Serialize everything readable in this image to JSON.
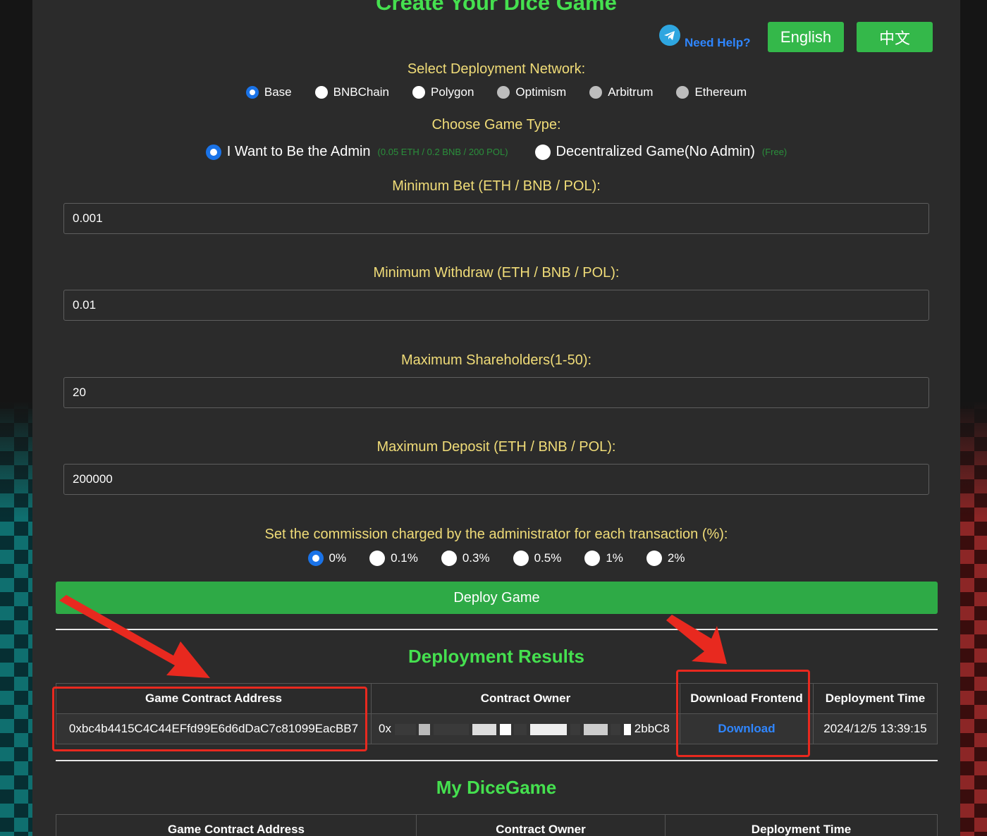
{
  "title": "Create Your Dice Game",
  "help": {
    "label": "Need Help?"
  },
  "languages": [
    "English",
    "中文"
  ],
  "network": {
    "label": "Select Deployment Network:",
    "options": [
      "Base",
      "BNBChain",
      "Polygon",
      "Optimism",
      "Arbitrum",
      "Ethereum"
    ],
    "selected": "Base"
  },
  "game_type": {
    "label": "Choose Game Type:",
    "admin": {
      "label": "I Want to Be the Admin",
      "cost": "(0.05 ETH / 0.2 BNB / 200 POL)"
    },
    "decentralized": {
      "label": "Decentralized Game(No Admin)",
      "cost": "(Free)"
    },
    "selected": "admin"
  },
  "fields": {
    "min_bet": {
      "label": "Minimum Bet (ETH / BNB / POL):",
      "value": "0.001"
    },
    "min_withdraw": {
      "label": "Minimum Withdraw (ETH / BNB / POL):",
      "value": "0.01"
    },
    "max_shareholders": {
      "label": "Maximum Shareholders(1-50):",
      "value": "20"
    },
    "max_deposit": {
      "label": "Maximum Deposit (ETH / BNB / POL):",
      "value": "200000"
    }
  },
  "commission": {
    "label": "Set the commission charged by the administrator for each transaction (%):",
    "options": [
      "0%",
      "0.1%",
      "0.3%",
      "0.5%",
      "1%",
      "2%"
    ],
    "selected": "0%"
  },
  "deploy_button": "Deploy Game",
  "results": {
    "title": "Deployment Results",
    "headers": [
      "Game Contract Address",
      "Contract Owner",
      "Download Frontend",
      "Deployment Time"
    ],
    "row": {
      "address": "0xbc4b4415C4C44EFfd99E6d6dDaC7c81099EacBB7",
      "owner_start": "0x",
      "owner_end": "2bbC8",
      "download": "Download",
      "time": "2024/12/5 13:39:15"
    }
  },
  "my_games": {
    "title": "My DiceGame",
    "headers": [
      "Game Contract Address",
      "Contract Owner",
      "Deployment Time"
    ]
  },
  "colors": {
    "accent_green": "#45e04f",
    "label_yellow": "#f0dc78",
    "button_green": "#2eaa46",
    "link_blue": "#2f86ff",
    "annotation_red": "#e8291f"
  }
}
